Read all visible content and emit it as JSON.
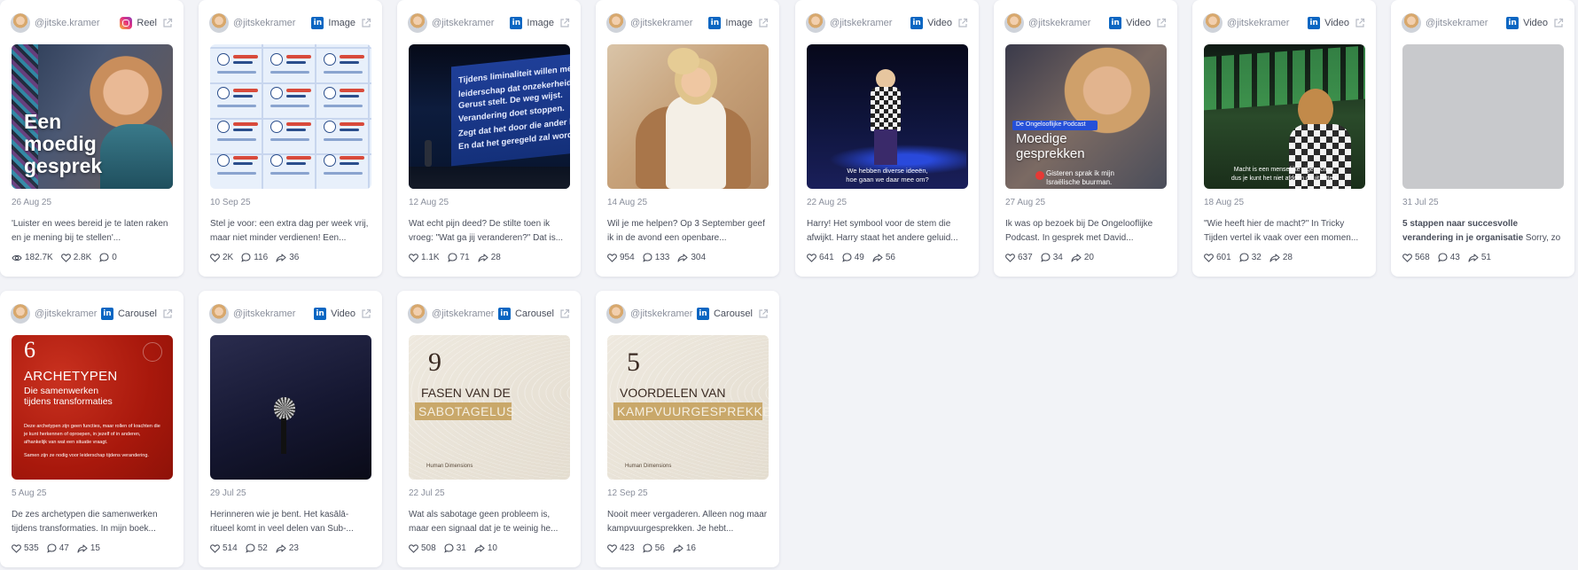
{
  "posts": [
    {
      "handle": "@jitske.kramer",
      "platform": "instagram",
      "type": "Reel",
      "date": "26 Aug 25",
      "caption": "'Luister en wees bereid je te laten raken en je mening bij te stellen'...",
      "views": "182.7K",
      "likes": "2.8K",
      "comments": "0",
      "thumb": {
        "kind": "portrait-overlay",
        "text": [
          "Een",
          "moedig",
          "gesprek"
        ]
      }
    },
    {
      "handle": "@jitskekramer",
      "platform": "linkedin",
      "type": "Image",
      "date": "10 Sep 25",
      "caption": "Stel je voor: een extra dag per week vrij, maar niet minder verdienen! Een...",
      "likes": "2K",
      "comments": "116",
      "shares": "36",
      "thumb": {
        "kind": "infographic"
      }
    },
    {
      "handle": "@jitskekramer",
      "platform": "linkedin",
      "type": "Image",
      "date": "12 Aug 25",
      "caption": "Wat echt pijn deed? De stilte toen ik vroeg: \"Wat ga jij veranderen?\" Dat is...",
      "likes": "1.1K",
      "comments": "71",
      "shares": "28",
      "thumb": {
        "kind": "stage-screen",
        "text": [
          "Tijdens liminaliteit willen mense",
          "leiderschap dat onzekerheid wegne",
          "Gerust stelt. De weg wijst.",
          "Verandering doet stoppen.",
          "Zegt dat het door die ander kom",
          "En dat het geregeld zal worden"
        ]
      }
    },
    {
      "handle": "@jitskekramer",
      "platform": "linkedin",
      "type": "Image",
      "date": "14 Aug 25",
      "caption": "Wil je me helpen? Op 3 September geef ik in de avond een openbare...",
      "likes": "954",
      "comments": "133",
      "shares": "304",
      "thumb": {
        "kind": "photo-chair"
      }
    },
    {
      "handle": "@jitskekramer",
      "platform": "linkedin",
      "type": "Video",
      "date": "22 Aug 25",
      "caption": "Harry! Het symbool voor de stem die afwijkt. Harry staat het andere geluid...",
      "likes": "641",
      "comments": "49",
      "shares": "56",
      "thumb": {
        "kind": "stage-dark",
        "text": [
          "We hebben diverse ideeën,",
          "hoe gaan we daar mee om?"
        ]
      }
    },
    {
      "handle": "@jitskekramer",
      "platform": "linkedin",
      "type": "Video",
      "date": "27 Aug 25",
      "caption": "Ik was op bezoek bij De Ongelooflijke Podcast. In gesprek met David...",
      "likes": "637",
      "comments": "34",
      "shares": "20",
      "thumb": {
        "kind": "podcast",
        "badge": "De Ongelooflijke Podcast",
        "text": [
          "Moedige",
          "gesprekken"
        ],
        "sub": [
          "Gisteren sprak ik mijn",
          "Israëlische buurman."
        ]
      }
    },
    {
      "handle": "@jitskekramer",
      "platform": "linkedin",
      "type": "Video",
      "date": "18 Aug 25",
      "caption": "\"Wie heeft hier de macht?\" In Tricky Tijden vertel ik vaak over een momen...",
      "likes": "601",
      "comments": "32",
      "shares": "28",
      "thumb": {
        "kind": "stage-green",
        "sub": [
          "Macht is een menselijke eigenschap,",
          "dus je kunt het niet afdoen of uitzetten."
        ]
      }
    },
    {
      "handle": "@jitskekramer",
      "platform": "linkedin",
      "type": "Video",
      "date": "31 Jul 25",
      "caption_bold": "5 stappen naar succesvolle verandering in je organisatie",
      "caption": " Sorry, zo makkelijk is het...",
      "likes": "568",
      "comments": "43",
      "shares": "51",
      "thumb": {
        "kind": "placeholder"
      }
    },
    {
      "handle": "@jitskekramer",
      "platform": "linkedin",
      "type": "Carousel",
      "date": "5 Aug 25",
      "caption": "De zes archetypen die samenwerken tijdens transformaties. In mijn boek...",
      "likes": "535",
      "comments": "47",
      "shares": "15",
      "thumb": {
        "kind": "red-card",
        "number": "6",
        "title": "ARCHETYPEN",
        "subtitle": [
          "Die samenwerken",
          "tijdens transformaties"
        ],
        "body": [
          "Deze archetypen zijn geen functies, maar rollen of krachten die",
          "je kunt herkennen of oproepen, in jezelf of in anderen,",
          "afhankelijk van wat een situatie vraagt.",
          "Samen zijn ze nodig voor leiderschap tijdens verandering."
        ]
      }
    },
    {
      "handle": "@jitskekramer",
      "platform": "linkedin",
      "type": "Video",
      "date": "29 Jul 25",
      "caption": "Herinneren wie je bent. Het kasālā-ritueel komt in veel delen van Sub-...",
      "likes": "514",
      "comments": "52",
      "shares": "23",
      "thumb": {
        "kind": "microphone"
      }
    },
    {
      "handle": "@jitskekramer",
      "platform": "linkedin",
      "type": "Carousel",
      "date": "22 Jul 25",
      "caption": "Wat als sabotage geen probleem is, maar een signaal dat je te weinig he...",
      "likes": "508",
      "comments": "31",
      "shares": "10",
      "thumb": {
        "kind": "beige-card",
        "number": "9",
        "line1": "FASEN VAN DE",
        "line2": "SABOTAGELUS",
        "footer": "Human Dimensions"
      }
    },
    {
      "handle": "@jitskekramer",
      "platform": "linkedin",
      "type": "Carousel",
      "date": "12 Sep 25",
      "caption": "Nooit meer vergaderen. Alleen nog maar kampvuurgesprekken. Je hebt...",
      "likes": "423",
      "comments": "56",
      "shares": "16",
      "thumb": {
        "kind": "beige-card",
        "number": "5",
        "line1": "VOORDELEN VAN",
        "line2": "KAMPVUURGESPREKKEN",
        "footer": "Human Dimensions"
      }
    }
  ],
  "colors": {
    "linkedin": "#0a66c2",
    "muted": "#8a8f9c",
    "text": "#4a4f5c",
    "background": "#f2f3f7"
  },
  "icons": {
    "views": "eye-icon",
    "likes": "heart-icon",
    "comments": "comment-icon",
    "shares": "share-icon",
    "external": "external-link-icon"
  }
}
